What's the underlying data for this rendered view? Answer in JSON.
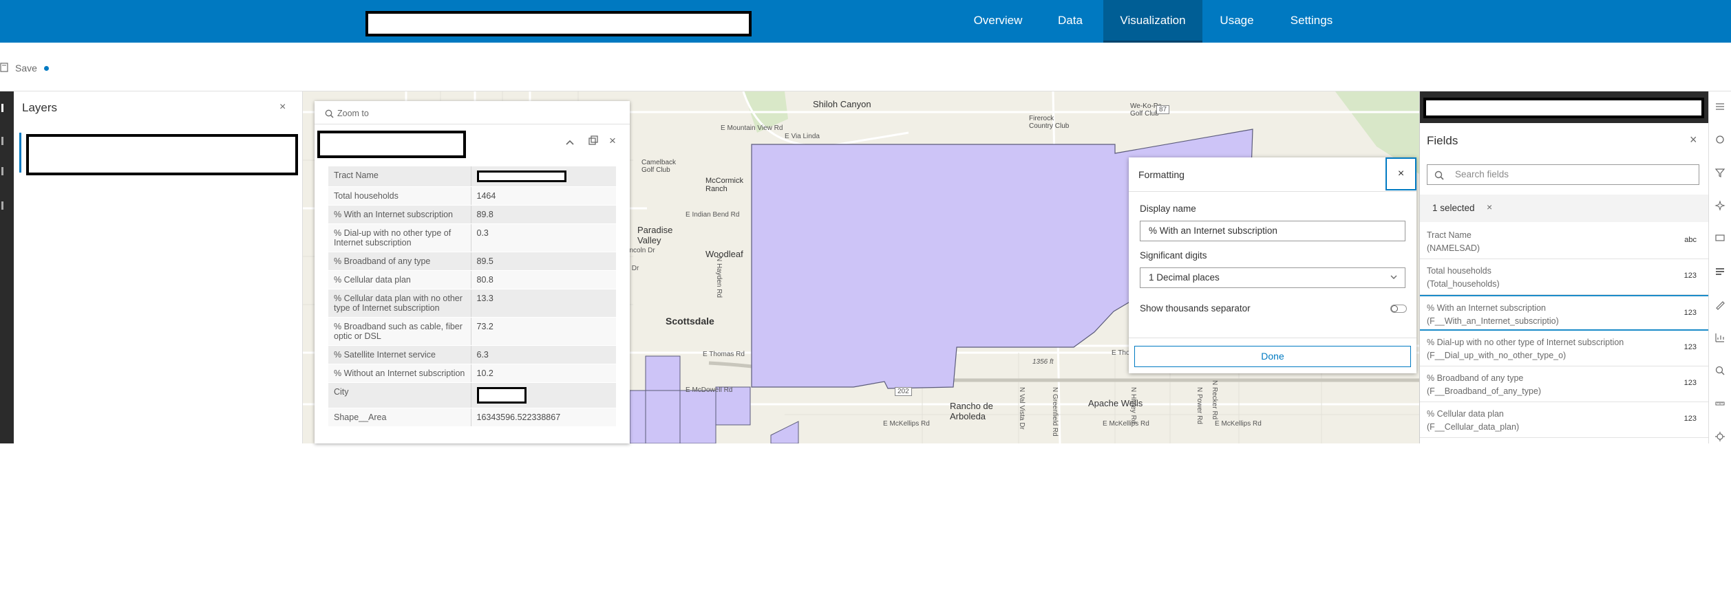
{
  "nav": {
    "tabs": [
      {
        "label": "Overview"
      },
      {
        "label": "Data"
      },
      {
        "label": "Visualization"
      },
      {
        "label": "Usage"
      },
      {
        "label": "Settings"
      }
    ],
    "active_tab": "Visualization"
  },
  "toolbar": {
    "save_label": "Save"
  },
  "layers": {
    "title": "Layers"
  },
  "popup": {
    "zoom_label": "Zoom to",
    "rows": [
      {
        "key": "Tract Name",
        "value": ""
      },
      {
        "key": "Total households",
        "value": "1464"
      },
      {
        "key": "% With an Internet subscription",
        "value": "89.8"
      },
      {
        "key": "% Dial-up with no other type of Internet subscription",
        "value": "0.3"
      },
      {
        "key": "% Broadband of any type",
        "value": "89.5"
      },
      {
        "key": "% Cellular data plan",
        "value": "80.8"
      },
      {
        "key": "% Cellular data plan with no other type of Internet subscription",
        "value": "13.3"
      },
      {
        "key": "% Broadband such as cable, fiber optic or DSL",
        "value": "73.2"
      },
      {
        "key": "% Satellite Internet service",
        "value": "6.3"
      },
      {
        "key": "% Without an Internet subscription",
        "value": "10.2"
      },
      {
        "key": "City",
        "value": ""
      },
      {
        "key": "Shape__Area",
        "value": "16343596.522338867"
      }
    ]
  },
  "map": {
    "labels": {
      "shiloh": "Shiloh Canyon",
      "wekopa": "We-Ko-Pa Golf Club",
      "firerock": "Firerock Country Club",
      "camelback": "Camelback Golf Club",
      "mccormick": "McCormick Ranch",
      "paradise": "Paradise Valley",
      "woodleaf": "Woodleaf",
      "scottsdale": "Scottsdale",
      "rancho": "Rancho de Arboleda",
      "apache": "Apache Wells",
      "mountain_view": "E Mountain View Rd",
      "via_linda": "E Via Linda",
      "indian_bend": "E Indian Bend Rd",
      "thomas": "E Thomas Rd",
      "mcdowell": "E McDowell Rd",
      "mckellips": "E McKellips Rd",
      "mckellips2": "E McKellips Rd",
      "mckellips3": "E McKellips Rd",
      "elevation": "1356 ft",
      "hayden": "N Hayden Rd",
      "valvista": "N Val Vista Dr",
      "greenfield": "N Greenfield Rd",
      "higley": "N Higley Rd",
      "recker": "N Recker Rd",
      "power": "N Power Rd",
      "thor": "E Thor",
      "rt87": "87",
      "rt202": "202",
      "k_dr": "k Dr",
      "lincoln": "lincoln Dr",
      "mcdowell_trunc": "E McDowell Rd"
    },
    "polygon_fill": "#cdc4f7",
    "polygon_stroke": "#5b5b7a"
  },
  "formatting": {
    "title": "Formatting",
    "display_name_label": "Display name",
    "display_name_value": "% With an Internet subscription",
    "sig_digits_label": "Significant digits",
    "sig_digits_value": "1 Decimal places",
    "thousands_label": "Show thousands separator",
    "done_label": "Done"
  },
  "fields": {
    "title": "Fields",
    "search_placeholder": "Search fields",
    "selected_label": "1 selected",
    "items": [
      {
        "name": "Tract Name",
        "alias": "(NAMELSAD)",
        "type": "abc"
      },
      {
        "name": "Total households",
        "alias": "(Total_households)",
        "type": "123"
      },
      {
        "name": "% With an Internet subscription",
        "alias": "(F__With_an_Internet_subscriptio)",
        "type": "123"
      },
      {
        "name": "% Dial-up with no other type of Internet subscription",
        "alias": "(F__Dial_up_with_no_other_type_o)",
        "type": "123"
      },
      {
        "name": "% Broadband of any type",
        "alias": "(F__Broadband_of_any_type)",
        "type": "123"
      },
      {
        "name": "% Cellular data plan",
        "alias": "(F__Cellular_data_plan)",
        "type": "123"
      }
    ]
  },
  "colors": {
    "brand": "#0079c1",
    "brand_dark": "#005e95",
    "accent": "#007ac2"
  }
}
